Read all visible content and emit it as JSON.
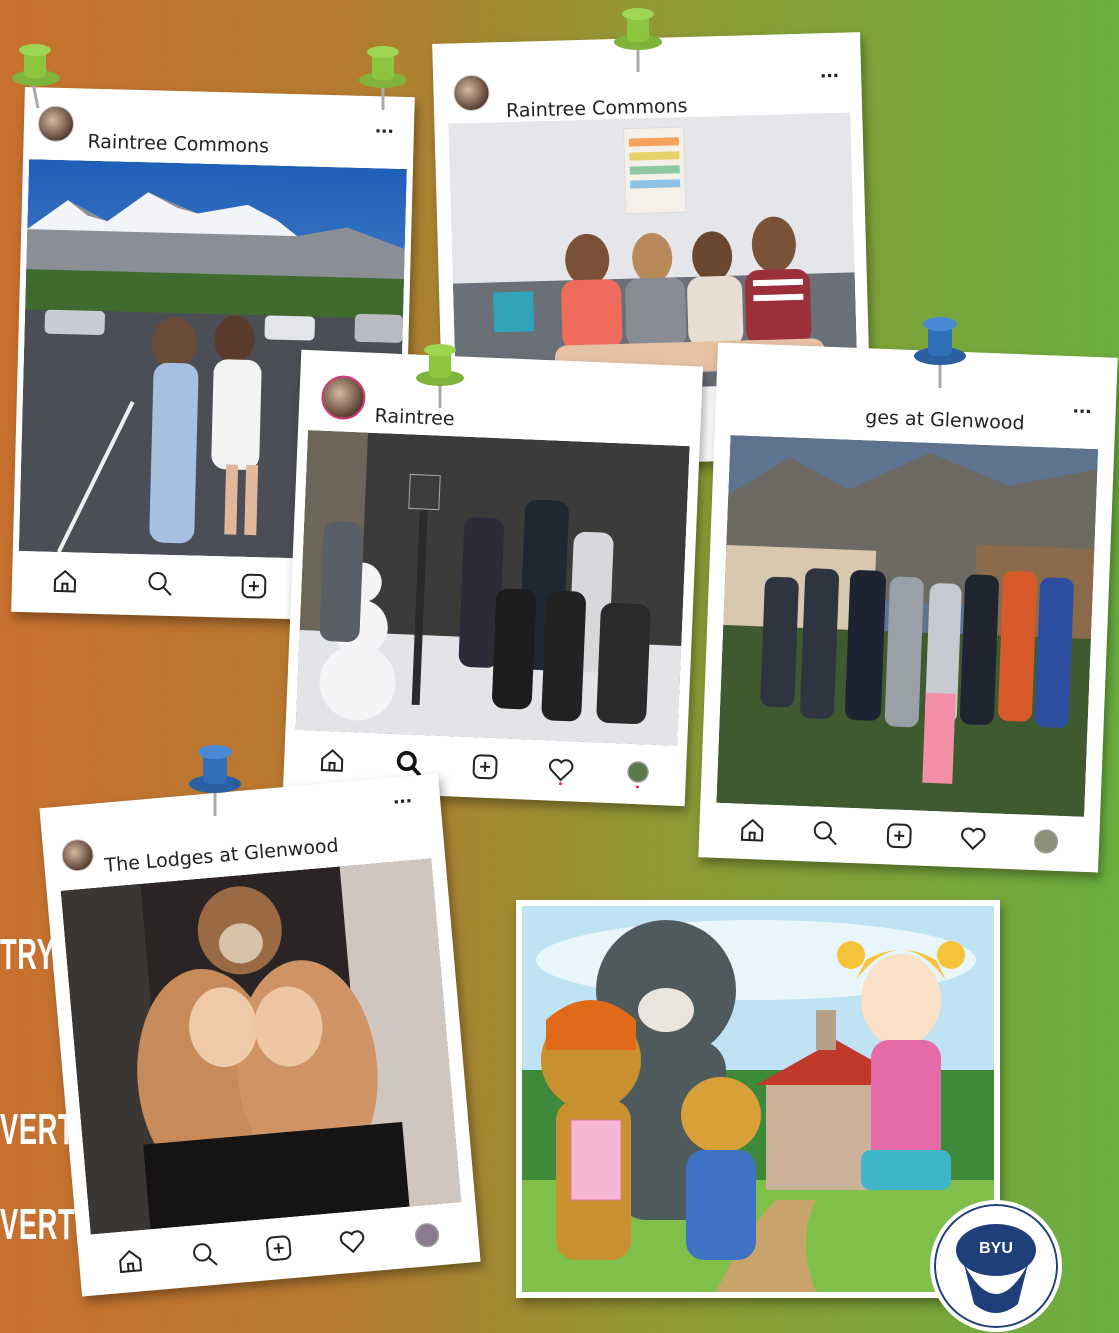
{
  "side_text": [
    "TRY",
    "VERT",
    "VERT"
  ],
  "posts": {
    "mountain": {
      "name": "Raintree Commons"
    },
    "room": {
      "name": "Raintree Commons"
    },
    "snow": {
      "name": "Raintree"
    },
    "group": {
      "name": "ges at Glenwood"
    },
    "cougar": {
      "name": "The Lodges at Glenwood"
    }
  },
  "icons": [
    "home-icon",
    "search-icon",
    "add-icon",
    "heart-icon",
    "profile-icon",
    "more-icon",
    "pin-icon"
  ],
  "badge": {
    "text": "BYU"
  },
  "colors": {
    "pin_green": "#8cc63f",
    "pin_blue": "#2f6fb7"
  }
}
